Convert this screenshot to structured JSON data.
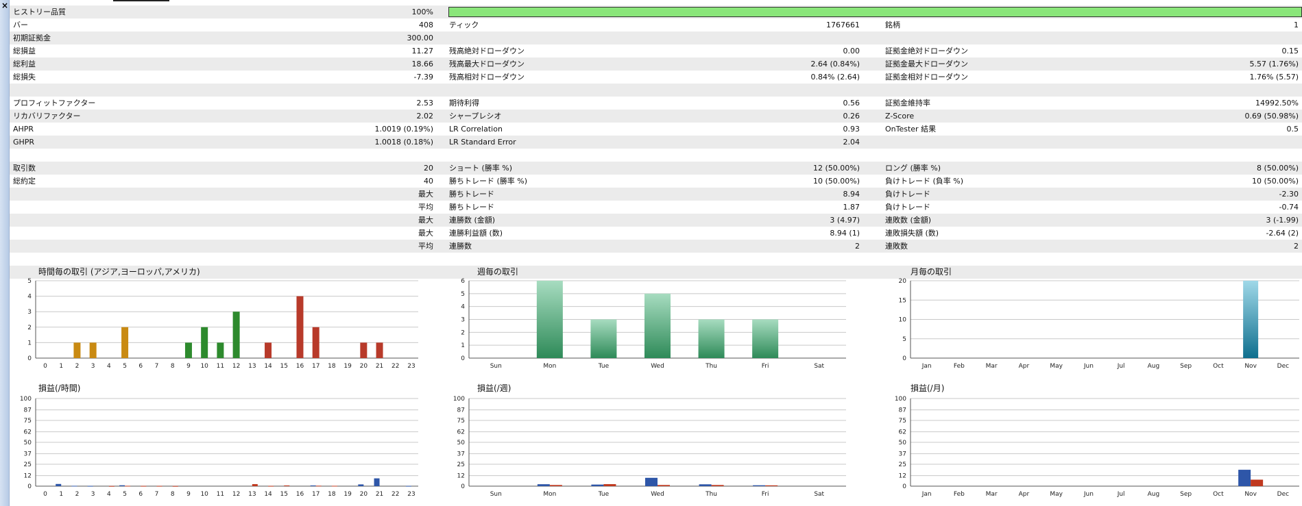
{
  "sidebar": {
    "close_glyph": "×"
  },
  "stats": {
    "rows": [
      {
        "shaded": true,
        "bar": true,
        "l1": "ヒストリー品質",
        "v1": "100%"
      },
      {
        "shaded": false,
        "l1": "バー",
        "v1": "408",
        "l2": "ティック",
        "v2": "1767661",
        "l3": "銘柄",
        "v3": "1"
      },
      {
        "shaded": true,
        "l1": "初期証拠金",
        "v1": "300.00"
      },
      {
        "shaded": false,
        "l1": "総損益",
        "v1": "11.27",
        "l2": "残高絶対ドローダウン",
        "v2": "0.00",
        "l3": "証拠金絶対ドローダウン",
        "v3": "0.15"
      },
      {
        "shaded": true,
        "l1": "総利益",
        "v1": "18.66",
        "l2": "残高最大ドローダウン",
        "v2": "2.64 (0.84%)",
        "l3": "証拠金最大ドローダウン",
        "v3": "5.57 (1.76%)"
      },
      {
        "shaded": false,
        "l1": "総損失",
        "v1": "-7.39",
        "l2": "残高相対ドローダウン",
        "v2": "0.84% (2.64)",
        "l3": "証拠金相対ドローダウン",
        "v3": "1.76% (5.57)"
      },
      {
        "shaded": true
      },
      {
        "shaded": false,
        "l1": "プロフィットファクター",
        "v1": "2.53",
        "l2": "期待利得",
        "v2": "0.56",
        "l3": "証拠金維持率",
        "v3": "14992.50%"
      },
      {
        "shaded": true,
        "l1": "リカバリファクター",
        "v1": "2.02",
        "l2": "シャープレシオ",
        "v2": "0.26",
        "l3": "Z-Score",
        "v3": "0.69 (50.98%)"
      },
      {
        "shaded": false,
        "l1": "AHPR",
        "v1": "1.0019 (0.19%)",
        "l2": "LR Correlation",
        "v2": "0.93",
        "l3": "OnTester 結果",
        "v3": "0.5"
      },
      {
        "shaded": true,
        "l1": "GHPR",
        "v1": "1.0018 (0.18%)",
        "l2": "LR Standard Error",
        "v2": "2.04"
      },
      {
        "shaded": false
      },
      {
        "shaded": true,
        "l1": "取引数",
        "v1": "20",
        "l2": "ショート (勝率 %)",
        "v2": "12 (50.00%)",
        "l3": "ロング (勝率 %)",
        "v3": "8 (50.00%)"
      },
      {
        "shaded": false,
        "l1": "総約定",
        "v1": "40",
        "l2": "勝ちトレード (勝率 %)",
        "v2": "10 (50.00%)",
        "l3": "負けトレード (負率 %)",
        "v3": "10 (50.00%)"
      },
      {
        "shaded": true,
        "v1": "最大",
        "l2": "勝ちトレード",
        "v2": "8.94",
        "l3": "負けトレード",
        "v3": "-2.30"
      },
      {
        "shaded": false,
        "v1": "平均",
        "l2": "勝ちトレード",
        "v2": "1.87",
        "l3": "負けトレード",
        "v3": "-0.74"
      },
      {
        "shaded": true,
        "v1": "最大",
        "l2": "連勝数 (金額)",
        "v2": "3 (4.97)",
        "l3": "連敗数 (金額)",
        "v3": "3 (-1.99)"
      },
      {
        "shaded": false,
        "v1": "最大",
        "l2": "連勝利益額 (数)",
        "v2": "8.94 (1)",
        "l3": "連敗損失額 (数)",
        "v3": "-2.64 (2)"
      },
      {
        "shaded": true,
        "v1": "平均",
        "l2": "連勝数",
        "v2": "2",
        "l3": "連敗数",
        "v3": "2"
      },
      {
        "shaded": false
      },
      {
        "shaded": true
      }
    ]
  },
  "colors": {
    "quality_bar": "#8ae67a",
    "asia": "#c98a12",
    "europe": "#2d8a2d",
    "america": "#b83a2a",
    "week_green": "#3a9c68",
    "month_teal": "#2a8fae",
    "profit_blue": "#2e56a8",
    "loss_red": "#c0391f"
  },
  "chart_data": [
    {
      "id": "hourly-trades",
      "type": "bar",
      "title": "時間毎の取引 (アジア,ヨーロッパ,アメリカ)",
      "categories": [
        "0",
        "1",
        "2",
        "3",
        "4",
        "5",
        "6",
        "7",
        "8",
        "9",
        "10",
        "11",
        "12",
        "13",
        "14",
        "15",
        "16",
        "17",
        "18",
        "19",
        "20",
        "21",
        "22",
        "23"
      ],
      "y_ticks": [
        "0",
        "1",
        "2",
        "3",
        "4",
        "5"
      ],
      "ylim": [
        0,
        5
      ],
      "series": [
        {
          "values": [
            0,
            0,
            1,
            1,
            0,
            2,
            0,
            0,
            0,
            1,
            2,
            1,
            3,
            0,
            1,
            0,
            4,
            2,
            0,
            0,
            1,
            1,
            0,
            0
          ]
        }
      ]
    },
    {
      "id": "weekly-trades",
      "type": "bar",
      "title": "週毎の取引",
      "categories": [
        "Sun",
        "Mon",
        "Tue",
        "Wed",
        "Thu",
        "Fri",
        "Sat"
      ],
      "y_ticks": [
        "0",
        "1",
        "2",
        "3",
        "4",
        "5",
        "6"
      ],
      "ylim": [
        0,
        6
      ],
      "series": [
        {
          "values": [
            0,
            6,
            3,
            5,
            3,
            3,
            0
          ]
        }
      ]
    },
    {
      "id": "monthly-trades",
      "type": "bar",
      "title": "月毎の取引",
      "categories": [
        "Jan",
        "Feb",
        "Mar",
        "Apr",
        "May",
        "Jun",
        "Jul",
        "Aug",
        "Sep",
        "Oct",
        "Nov",
        "Dec"
      ],
      "y_ticks": [
        "0",
        "5",
        "10",
        "15",
        "20"
      ],
      "ylim": [
        0,
        20
      ],
      "series": [
        {
          "values": [
            0,
            0,
            0,
            0,
            0,
            0,
            0,
            0,
            0,
            0,
            20,
            0
          ]
        }
      ]
    },
    {
      "id": "hourly-pnl",
      "type": "bar",
      "title": "損益(/時間)",
      "categories": [
        "0",
        "1",
        "2",
        "3",
        "4",
        "5",
        "6",
        "7",
        "8",
        "9",
        "10",
        "11",
        "12",
        "13",
        "14",
        "15",
        "16",
        "17",
        "18",
        "19",
        "20",
        "21",
        "22",
        "23"
      ],
      "y_ticks": [
        "0",
        "12",
        "25",
        "37",
        "50",
        "62",
        "75",
        "87",
        "100"
      ],
      "ylim": [
        0,
        100
      ],
      "series": [
        {
          "values": [
            0,
            2.5,
            0.4,
            0.3,
            0,
            1,
            0,
            0,
            0,
            0,
            0,
            0,
            0,
            0,
            0,
            0,
            0,
            0.8,
            0,
            0,
            2,
            8.9,
            0,
            0.3
          ]
        },
        {
          "values": [
            0,
            0,
            0,
            0,
            0.2,
            0.4,
            0.3,
            0.3,
            0.2,
            0,
            0,
            0,
            0,
            2.3,
            0.3,
            0.8,
            0,
            0.5,
            0.4,
            0,
            0,
            0,
            0,
            0
          ]
        }
      ]
    },
    {
      "id": "weekly-pnl",
      "type": "bar",
      "title": "損益(/週)",
      "categories": [
        "Sun",
        "Mon",
        "Tue",
        "Wed",
        "Thu",
        "Fri",
        "Sat"
      ],
      "y_ticks": [
        "0",
        "12",
        "25",
        "37",
        "50",
        "62",
        "75",
        "87",
        "100"
      ],
      "ylim": [
        0,
        100
      ],
      "series": [
        {
          "values": [
            0,
            2.2,
            1.8,
            9.5,
            2.1,
            1.0,
            0
          ]
        },
        {
          "values": [
            0,
            1.3,
            2.3,
            1.3,
            1.3,
            0.9,
            0
          ]
        }
      ]
    },
    {
      "id": "monthly-pnl",
      "type": "bar",
      "title": "損益(/月)",
      "categories": [
        "Jan",
        "Feb",
        "Mar",
        "Apr",
        "May",
        "Jun",
        "Jul",
        "Aug",
        "Sep",
        "Oct",
        "Nov",
        "Dec"
      ],
      "y_ticks": [
        "0",
        "12",
        "25",
        "37",
        "50",
        "62",
        "75",
        "87",
        "100"
      ],
      "ylim": [
        0,
        100
      ],
      "series": [
        {
          "values": [
            0,
            0,
            0,
            0,
            0,
            0,
            0,
            0,
            0,
            0,
            18.7,
            0
          ]
        },
        {
          "values": [
            0,
            0,
            0,
            0,
            0,
            0,
            0,
            0,
            0,
            0,
            7.4,
            0
          ]
        }
      ]
    }
  ]
}
